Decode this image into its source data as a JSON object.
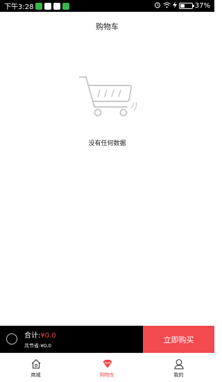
{
  "status_bar": {
    "time": "下午3:28",
    "battery_percent": "37%",
    "battery_level": 0.37,
    "notification_icons": [
      "wechat-icon",
      "qq-icon",
      "qq-icon",
      "app-icon"
    ],
    "system_icons": [
      "alarm-icon",
      "wifi-icon",
      "charging-icon",
      "battery-icon"
    ]
  },
  "header": {
    "title": "购物车"
  },
  "empty_state": {
    "icon": "shopping-cart-icon",
    "message": "没有任何数据"
  },
  "checkout": {
    "total_label": "合计:",
    "total_amount": "¥0.0",
    "saved_text": "共节省:¥0.0",
    "buy_label": "立即购买"
  },
  "tabs": [
    {
      "label": "商城",
      "icon": "home-icon",
      "active": false
    },
    {
      "label": "购物车",
      "icon": "cart-diamond-icon",
      "active": true
    },
    {
      "label": "我的",
      "icon": "profile-icon",
      "active": false
    }
  ],
  "colors": {
    "accent": "#f24a4f",
    "checkout_bar": "#000000",
    "active_tab": "#f0484a"
  }
}
